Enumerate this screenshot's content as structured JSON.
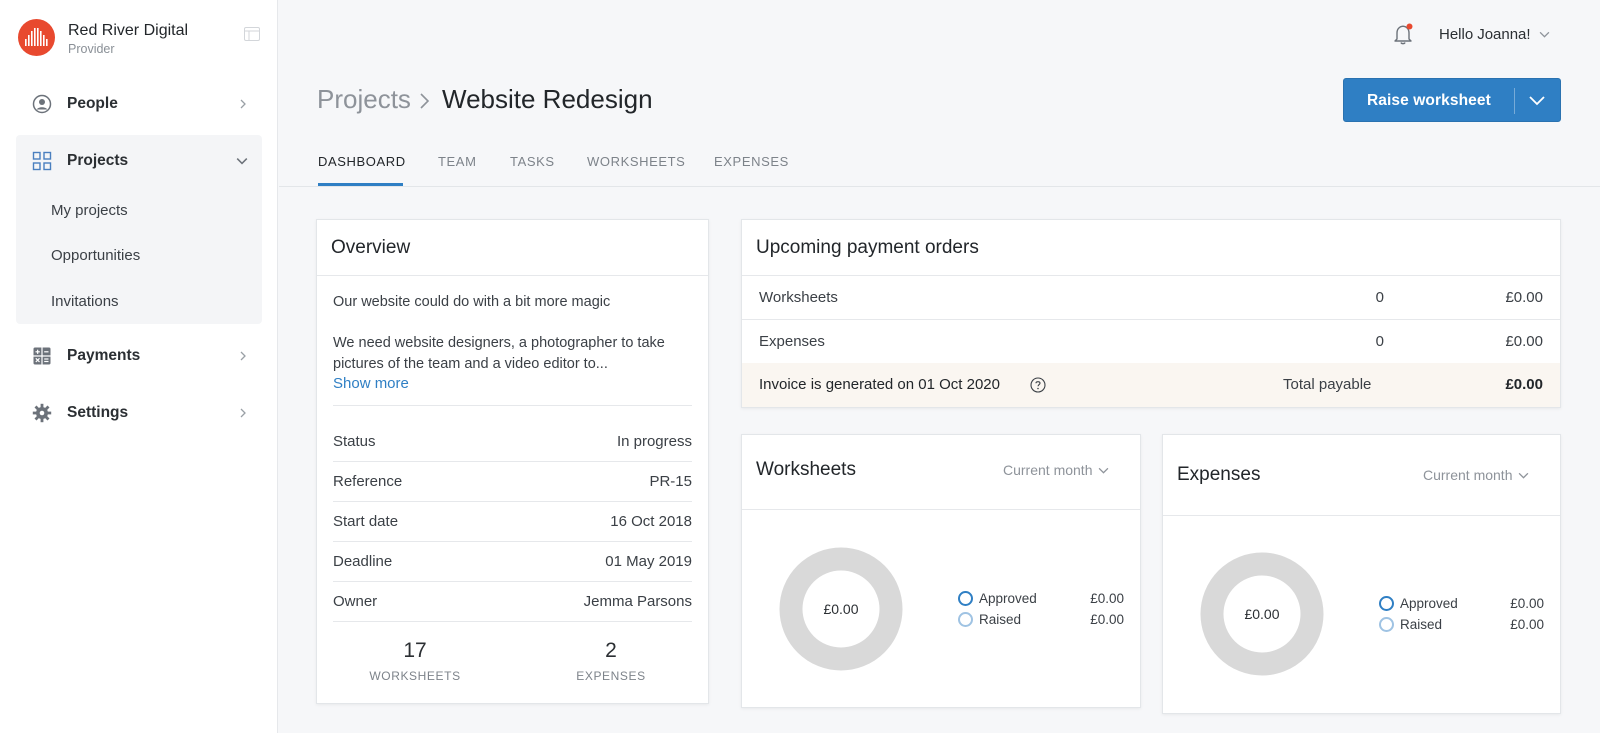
{
  "brand": {
    "name": "Red River Digital",
    "role": "Provider"
  },
  "sidebar": {
    "people": "People",
    "projects": "Projects",
    "projects_sub": [
      "My projects",
      "Opportunities",
      "Invitations"
    ],
    "payments": "Payments",
    "settings": "Settings"
  },
  "topbar": {
    "greeting": "Hello",
    "user": "Joanna!"
  },
  "breadcrumb": {
    "parent": "Projects",
    "current": "Website Redesign"
  },
  "actions": {
    "raise_worksheet": "Raise worksheet"
  },
  "tabs": [
    "DASHBOARD",
    "TEAM",
    "TASKS",
    "WORKSHEETS",
    "EXPENSES"
  ],
  "overview": {
    "title": "Overview",
    "summary": "Our website could do with a bit more magic",
    "description": "We need website designers, a photographer to take pictures of the team and a video editor to...",
    "show_more": "Show more",
    "details": [
      {
        "label": "Status",
        "value": "In progress"
      },
      {
        "label": "Reference",
        "value": "PR-15"
      },
      {
        "label": "Start date",
        "value": "16 Oct 2018"
      },
      {
        "label": "Deadline",
        "value": "01 May 2019"
      },
      {
        "label": "Owner",
        "value": "Jemma Parsons"
      }
    ],
    "stats": [
      {
        "value": "17",
        "label": "WORKSHEETS"
      },
      {
        "value": "2",
        "label": "EXPENSES"
      }
    ]
  },
  "payment_orders": {
    "title": "Upcoming payment orders",
    "rows": [
      {
        "label": "Worksheets",
        "count": "0",
        "amount": "£0.00"
      },
      {
        "label": "Expenses",
        "count": "0",
        "amount": "£0.00"
      }
    ],
    "invoice_note": "Invoice is generated on 01 Oct 2020",
    "total_label": "Total payable",
    "total_amount": "£0.00"
  },
  "worksheets_card": {
    "title": "Worksheets",
    "period": "Current month",
    "center": "£0.00",
    "legend": [
      {
        "label": "Approved",
        "value": "£0.00"
      },
      {
        "label": "Raised",
        "value": "£0.00"
      }
    ]
  },
  "expenses_card": {
    "title": "Expenses",
    "period": "Current month",
    "center": "£0.00",
    "legend": [
      {
        "label": "Approved",
        "value": "£0.00"
      },
      {
        "label": "Raised",
        "value": "£0.00"
      }
    ]
  },
  "colors": {
    "accent": "#2f7fc4",
    "brand": "#e8492f",
    "donut_empty": "#d9d9d9",
    "total_row_bg": "#faf6f1"
  },
  "icons": [
    "logo-icon",
    "layout-switch-icon",
    "user-circle-icon",
    "grid-icon",
    "calculator-icon",
    "gear-icon",
    "bell-icon",
    "chevron-down-icon",
    "chevron-right-icon",
    "question-circle-icon"
  ]
}
